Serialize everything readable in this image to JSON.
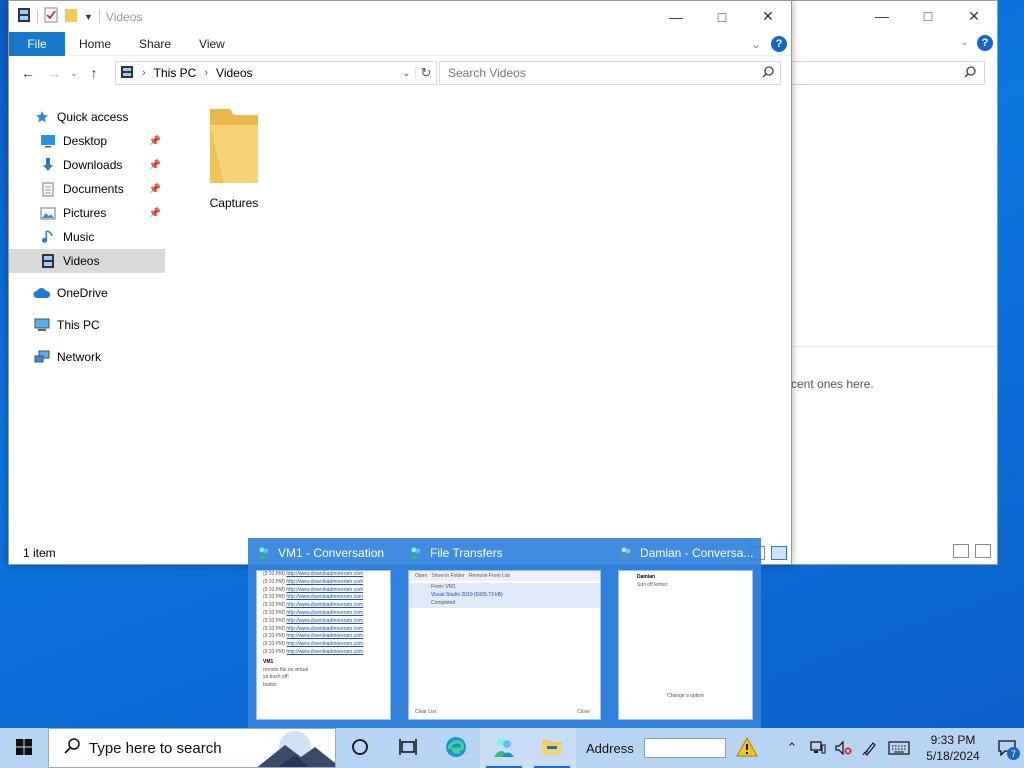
{
  "window": {
    "title": "Videos",
    "ribbon_tabs": [
      "File",
      "Home",
      "Share",
      "View"
    ],
    "address": {
      "crumbs": [
        "This PC",
        "Videos"
      ]
    },
    "search": {
      "placeholder": "Search Videos"
    },
    "nav": {
      "quick_access": "Quick access",
      "pinned": [
        {
          "label": "Desktop",
          "icon": "desktop-icon",
          "pinned": true
        },
        {
          "label": "Downloads",
          "icon": "downloads-icon",
          "pinned": true
        },
        {
          "label": "Documents",
          "icon": "documents-icon",
          "pinned": true
        },
        {
          "label": "Pictures",
          "icon": "pictures-icon",
          "pinned": true
        },
        {
          "label": "Music",
          "icon": "music-icon",
          "pinned": false
        },
        {
          "label": "Videos",
          "icon": "videos-icon",
          "pinned": false,
          "selected": true
        }
      ],
      "onedrive": "OneDrive",
      "thispc": "This PC",
      "network": "Network"
    },
    "items": [
      {
        "label": "Captures",
        "icon": "folder-icon"
      }
    ],
    "status": "1 item"
  },
  "background_window": {
    "message_fragment": "cent ones here."
  },
  "thumbnails": [
    {
      "title": "VM1 - Conversation",
      "icon": "messenger-icon"
    },
    {
      "title": "File Transfers",
      "icon": "messenger-icon"
    },
    {
      "title": "Damian - Conversa...",
      "icon": "messenger-icon"
    }
  ],
  "thumb_content": {
    "link": "http://www.downloadmoreram.com",
    "vm1_name": "VM1",
    "vm1_line1": "remote file on virtual",
    "vm1_line2": "ya bush off!",
    "vm1_line3": "bubbs",
    "ft_btn1": "Open",
    "ft_btn2": "Show in Folder",
    "ft_btn3": "Remove From List",
    "ft_from": "From: VM1",
    "ft_file": "Visual Studio 2019 (5005.73 kB)",
    "ft_status": "Completed",
    "ft_clear": "Clear List",
    "ft_close": "Close",
    "damian_name": "Damian",
    "damian_msg": "Sun off lettrez",
    "damian_footer": "Change a option"
  },
  "taskbar": {
    "search_placeholder": "Type here to search",
    "address_label": "Address",
    "time": "9:33 PM",
    "date": "5/18/2024",
    "notification_count": "7"
  },
  "colors": {
    "accent": "#1979ca",
    "taskbar": "#b7d4f2",
    "folder": "#f2c95b",
    "selection": "#d9d9d9"
  }
}
